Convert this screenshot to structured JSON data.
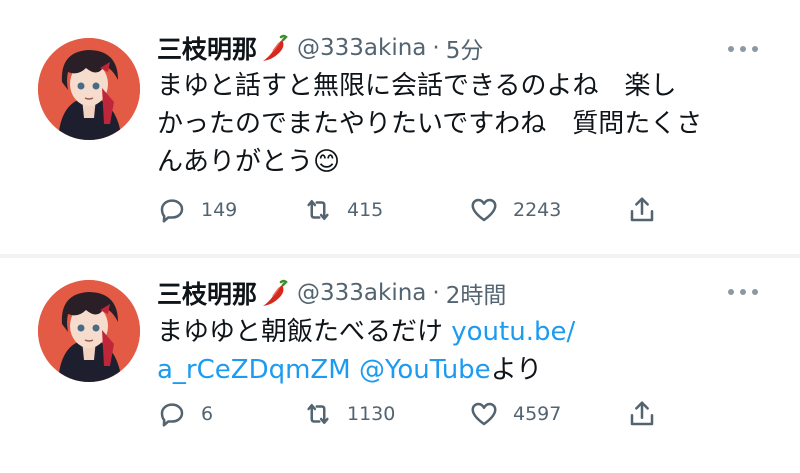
{
  "tweets": [
    {
      "author_name": "三枝明那",
      "handle": "@333akina",
      "separator": "·",
      "time": "5分",
      "text_lines": [
        "まゆと話すと無限に会話できるのよね　楽し",
        "かったのでまたやりたいですわね　質問たくさ",
        "んありがとう"
      ],
      "emoji": "😊",
      "replies": "149",
      "retweets": "415",
      "likes": "2243"
    },
    {
      "author_name": "三枝明那",
      "handle": "@333akina",
      "separator": "·",
      "time": "2時間",
      "text_line1_plain": "まゆゆと朝飯たべるだけ ",
      "link_part1": "youtu.be/",
      "link_part2": "a_rCeZDqmZM",
      "mention": "@YouTube",
      "text_suffix": "より",
      "replies": "6",
      "retweets": "1130",
      "likes": "4597"
    }
  ],
  "icons": {
    "reply": "reply-icon",
    "retweet": "retweet-icon",
    "like": "heart-icon",
    "share": "share-icon",
    "more": "more-icon",
    "chili": "chili-pepper-icon"
  },
  "colors": {
    "link": "#1d9bf0",
    "secondary": "#536471",
    "avatar_bg": "#e35a45"
  }
}
